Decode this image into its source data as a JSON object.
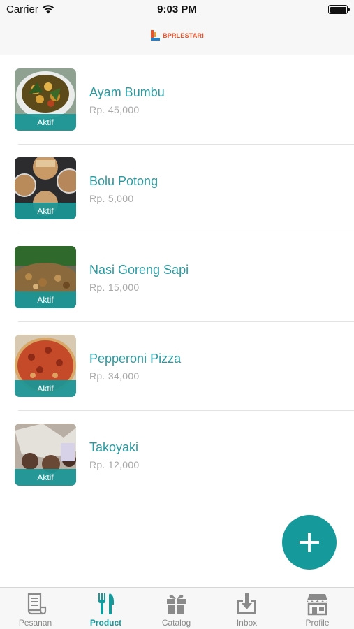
{
  "status_bar": {
    "carrier": "Carrier",
    "time": "9:03 PM"
  },
  "header": {
    "logo_text": "BPRLESTARI"
  },
  "products": [
    {
      "name": "Ayam Bumbu",
      "price": "Rp. 45,000",
      "status": "Aktif"
    },
    {
      "name": "Bolu Potong",
      "price": "Rp. 5,000",
      "status": "Aktif"
    },
    {
      "name": "Nasi Goreng Sapi",
      "price": "Rp. 15,000",
      "status": "Aktif"
    },
    {
      "name": "Pepperoni Pizza",
      "price": "Rp. 34,000",
      "status": "Aktif"
    },
    {
      "name": "Takoyaki",
      "price": "Rp. 12,000",
      "status": "Aktif"
    }
  ],
  "fab": {
    "icon": "plus-icon"
  },
  "tabs": [
    {
      "label": "Pesanan",
      "icon": "receipt-icon",
      "active": false
    },
    {
      "label": "Product",
      "icon": "fork-knife-icon",
      "active": true
    },
    {
      "label": "Catalog",
      "icon": "gift-icon",
      "active": false
    },
    {
      "label": "Inbox",
      "icon": "inbox-download-icon",
      "active": false
    },
    {
      "label": "Profile",
      "icon": "store-icon",
      "active": false
    }
  ],
  "colors": {
    "accent": "#16999b",
    "product_name": "#2b9aa0",
    "price": "#a8a8a8",
    "logo": "#e8532b"
  }
}
